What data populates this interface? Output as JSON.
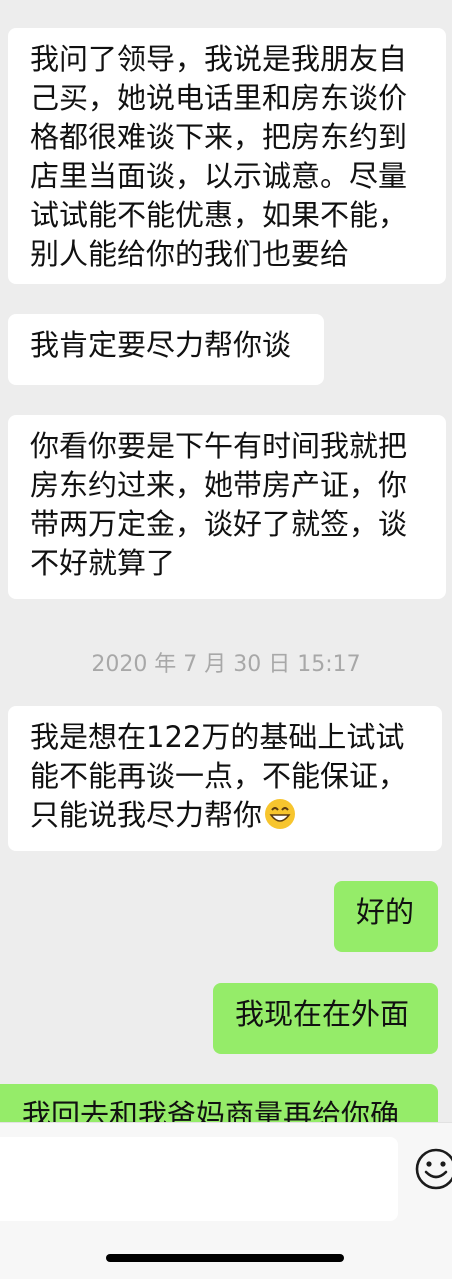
{
  "messages": [
    {
      "side": "incoming",
      "text": "我问了领导，我说是我朋友自己买，她说电话里和房东谈价格都很难谈下来，把房东约到店里当面谈，以示诚意。尽量试试能不能优惠，如果不能，别人能给你的我们也要给"
    },
    {
      "side": "incoming",
      "text": "我肯定要尽力帮你谈"
    },
    {
      "side": "incoming",
      "text": "你看你要是下午有时间我就把房东约过来，她带房产证，你带两万定金，谈好了就签，谈不好就算了"
    },
    {
      "side": "incoming",
      "text": "我是想在122万的基础上试试能不能再谈一点，不能保证，只能说我尽力帮你",
      "emoji": "grinning-face-emoji"
    },
    {
      "side": "outgoing",
      "text": "好的"
    },
    {
      "side": "outgoing",
      "text": "我现在在外面"
    },
    {
      "side": "outgoing",
      "text": "我回去和我爸妈商量再给你确"
    }
  ],
  "timestamp": "2020 年 7 月 30 日 15:17",
  "input": {
    "value": "",
    "emoji_icon": "smiley-face-icon"
  },
  "colors": {
    "background": "#ededed",
    "incoming_bubble": "#ffffff",
    "outgoing_bubble": "#95ec69",
    "timestamp_text": "#a8a8a8"
  }
}
